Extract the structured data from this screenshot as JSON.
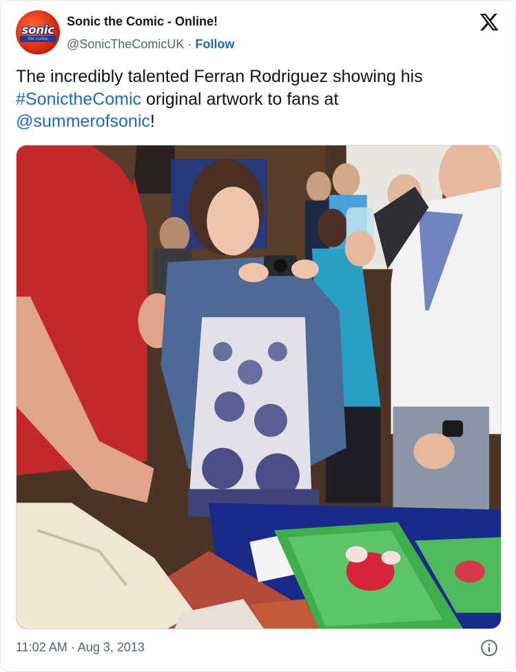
{
  "account": {
    "display_name": "Sonic the Comic - Online!",
    "handle": "@SonicTheComicUK",
    "separator": "·",
    "follow_label": "Follow",
    "avatar_text": "sonic",
    "avatar_subtext": "the comic"
  },
  "tweet": {
    "text_part1": "The incredibly talented Ferran Rodriguez showing his ",
    "hashtag": "#SonictheComic",
    "text_part2": " original artwork to fans at ",
    "mention": "@summerofsonic",
    "text_part3": "!"
  },
  "meta": {
    "time": "11:02 AM",
    "separator": "·",
    "date": "Aug 3, 2013"
  },
  "icons": {
    "platform": "x-logo-icon",
    "info": "info-icon"
  },
  "colors": {
    "link": "#1d69c9",
    "secondary_text": "#536471",
    "primary_text": "#0f1419"
  }
}
